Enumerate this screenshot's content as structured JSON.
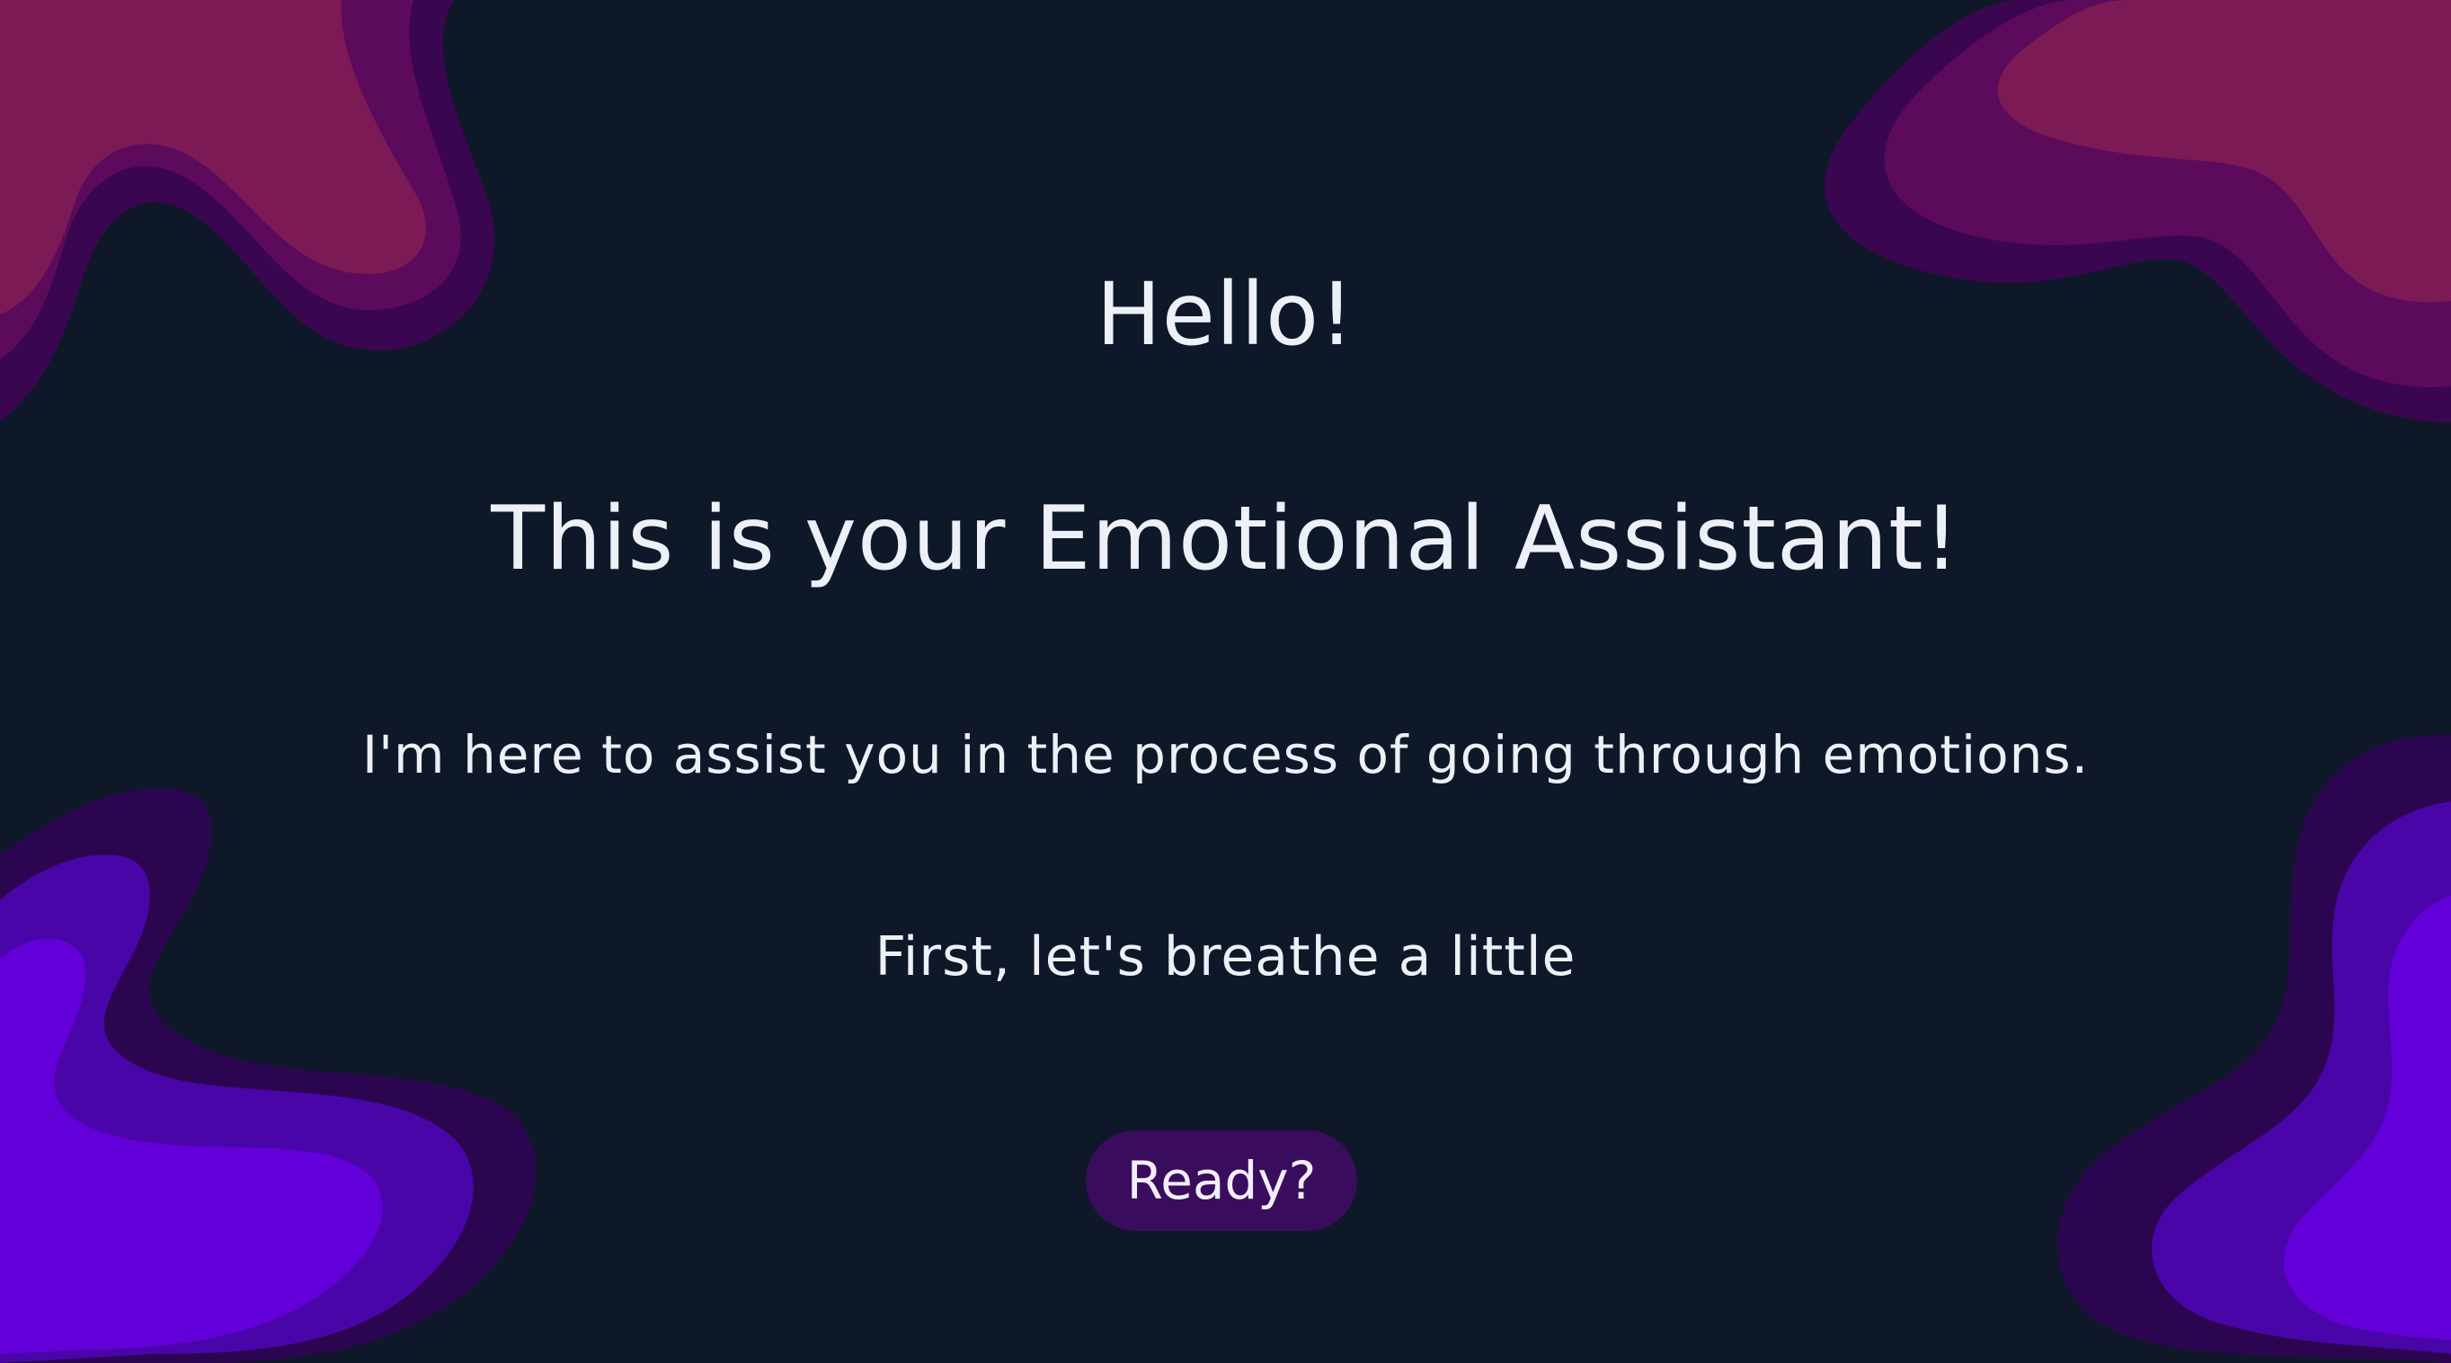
{
  "greeting": {
    "hello": "Hello!",
    "title": "This is your Emotional Assistant!",
    "intro": "I'm here to assist you in the process of going through emotions.",
    "prompt": "First, let's breathe a little"
  },
  "actions": {
    "ready_label": "Ready?"
  },
  "colors": {
    "background": "#0f1829",
    "text": "#eef0f7",
    "button_background": "#3a0c5e",
    "blob_magenta_outer": "#3a0650",
    "blob_magenta_mid": "#5c0a5c",
    "blob_magenta_inner": "#7c1a55",
    "blob_violet_outer": "#2c0550",
    "blob_violet_mid": "#4a05a8",
    "blob_violet_inner": "#6300d9"
  }
}
